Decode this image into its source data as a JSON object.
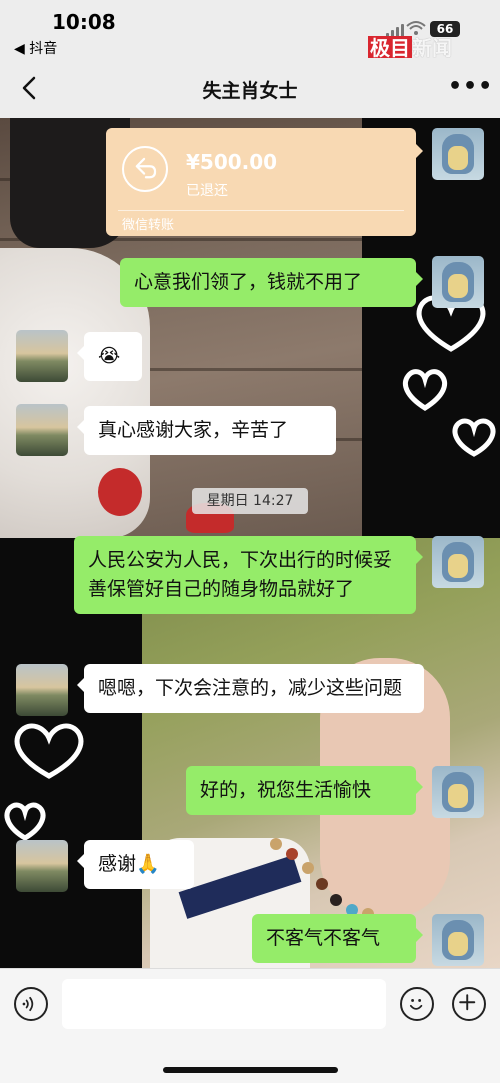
{
  "status_bar": {
    "time": "10:08",
    "back_app": "◀ 抖音",
    "battery": "66",
    "watermark": {
      "part_a": "极目",
      "part_b": "新闻"
    }
  },
  "nav": {
    "title": "失主肖女士",
    "more_icon": "more-icon"
  },
  "transfer": {
    "amount": "¥500.00",
    "status": "已退还",
    "type_label": "微信转账",
    "icon": "return-arrow-icon",
    "color": "#f8d9b3"
  },
  "messages": [
    {
      "side": "self",
      "text": "心意我们领了，钱就不用了"
    },
    {
      "side": "other",
      "text": "😭"
    },
    {
      "side": "other",
      "text": "真心感谢大家，辛苦了"
    },
    {
      "side": "self",
      "text": "人民公安为人民，下次出行的时候妥善保管好自己的随身物品就好了"
    },
    {
      "side": "other",
      "text": "嗯嗯，下次会注意的，减少这些问题"
    },
    {
      "side": "self",
      "text": "好的，祝您生活愉快"
    },
    {
      "side": "other",
      "text": "感谢🙏"
    },
    {
      "side": "self",
      "text": "不客气不客气"
    }
  ],
  "timestamp": "星期日 14:27",
  "input_bar": {
    "voice_icon": "voice-icon",
    "emoji_icon": "emoji-icon",
    "plus_icon": "plus-icon",
    "placeholder": ""
  },
  "colors": {
    "self_bubble": "#95ec69",
    "other_bubble": "#ffffff",
    "background": "#ededed"
  }
}
